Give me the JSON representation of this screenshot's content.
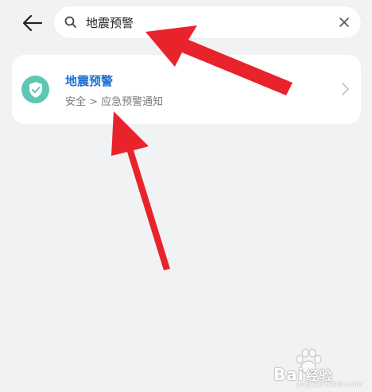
{
  "search": {
    "value": "地震预警",
    "icon": "search-icon",
    "clear_icon": "close-icon"
  },
  "nav": {
    "back_icon": "back-arrow-icon"
  },
  "results": [
    {
      "title": "地震预警",
      "path": "安全 > 应急预警通知",
      "icon": "shield-check-icon",
      "icon_color": "#5ec6b4",
      "title_color": "#1f6fd0"
    }
  ],
  "watermark": {
    "brand_latin": "Bai",
    "brand_cn": "经验",
    "sub": "jingyan.baidu.com"
  },
  "colors": {
    "background": "#f1f2f4",
    "annotation_arrow": "#e8232b"
  }
}
